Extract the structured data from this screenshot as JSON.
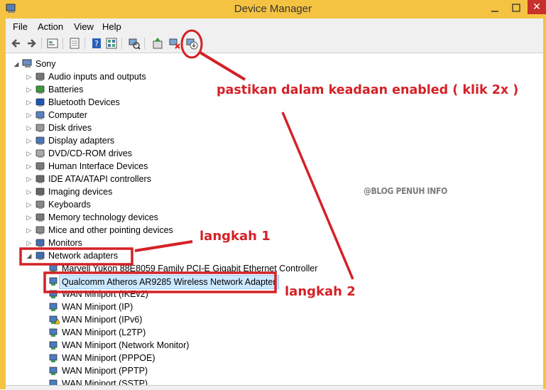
{
  "window": {
    "title": "Device Manager",
    "close_glyph": "✕"
  },
  "menu": [
    "File",
    "Action",
    "View",
    "Help"
  ],
  "toolbar_icons": [
    "back-icon",
    "forward-icon",
    "device-view-icon",
    "properties-icon",
    "help-icon",
    "device-grid-icon",
    "scan-hardware-icon",
    "update-driver-icon",
    "uninstall-icon",
    "enable-device-icon"
  ],
  "tree": {
    "root": "Sony",
    "categories": [
      {
        "label": "Audio inputs and outputs",
        "icon": "speaker-icon"
      },
      {
        "label": "Batteries",
        "icon": "battery-icon"
      },
      {
        "label": "Bluetooth Devices",
        "icon": "bluetooth-icon"
      },
      {
        "label": "Computer",
        "icon": "computer-icon"
      },
      {
        "label": "Disk drives",
        "icon": "disk-icon"
      },
      {
        "label": "Display adapters",
        "icon": "display-icon"
      },
      {
        "label": "DVD/CD-ROM drives",
        "icon": "dvd-icon"
      },
      {
        "label": "Human Interface Devices",
        "icon": "hid-icon"
      },
      {
        "label": "IDE ATA/ATAPI controllers",
        "icon": "ide-icon"
      },
      {
        "label": "Imaging devices",
        "icon": "camera-icon"
      },
      {
        "label": "Keyboards",
        "icon": "keyboard-icon"
      },
      {
        "label": "Memory technology devices",
        "icon": "memory-icon"
      },
      {
        "label": "Mice and other pointing devices",
        "icon": "mouse-icon"
      },
      {
        "label": "Monitors",
        "icon": "monitor-icon"
      },
      {
        "label": "Network adapters",
        "icon": "network-icon"
      }
    ],
    "network_children": [
      "Marvell Yukon 88E8059 Family PCI-E Gigabit Ethernet Controller",
      "Qualcomm Atheros AR9285 Wireless Network Adapter",
      "WAN Miniport (IKEv2)",
      "WAN Miniport (IP)",
      "WAN Miniport (IPv6)",
      "WAN Miniport (L2TP)",
      "WAN Miniport (Network Monitor)",
      "WAN Miniport (PPPOE)",
      "WAN Miniport (PPTP)",
      "WAN Miniport (SSTP)"
    ],
    "selected": "Qualcomm Atheros AR9285 Wireless Network Adapter"
  },
  "annotations": {
    "enabled_note": "pastikan dalam keadaan enabled  ( klik 2x )",
    "step1": "langkah 1",
    "step2": "langkah 2",
    "watermark": "@BLOG PENUH INFO",
    "color": "#d42127"
  }
}
